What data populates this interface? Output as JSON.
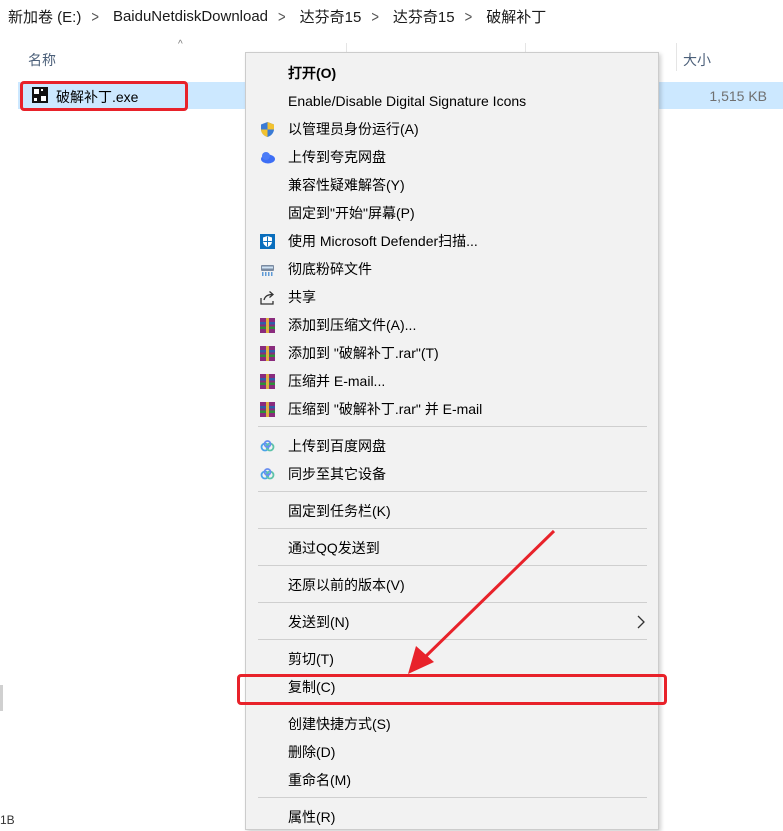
{
  "breadcrumb": {
    "items": [
      "新加卷 (E:)",
      "BaiduNetdiskDownload",
      "达芬奇15",
      "达芬奇15",
      "破解补丁"
    ],
    "separator": ">"
  },
  "file_list": {
    "header": {
      "name": "名称",
      "size": "大小"
    },
    "row": {
      "name": "破解补丁.exe",
      "size": "1,515 KB"
    }
  },
  "status_bar": {
    "fragment": "1B"
  },
  "context_menu": {
    "items": [
      {
        "label": "打开(O)",
        "bold": true
      },
      {
        "label": "Enable/Disable Digital Signature Icons"
      },
      {
        "label": "以管理员身份运行(A)",
        "icon": "uac-shield-icon"
      },
      {
        "label": "上传到夸克网盘",
        "icon": "quark-cloud-icon"
      },
      {
        "label": "兼容性疑难解答(Y)"
      },
      {
        "label": "固定到\"开始\"屏幕(P)"
      },
      {
        "label": "使用 Microsoft Defender扫描...",
        "icon": "defender-icon"
      },
      {
        "label": "彻底粉碎文件",
        "icon": "shredder-icon"
      },
      {
        "label": "共享",
        "icon": "share-icon"
      },
      {
        "label": "添加到压缩文件(A)...",
        "icon": "winrar-icon"
      },
      {
        "label": "添加到 \"破解补丁.rar\"(T)",
        "icon": "winrar-icon"
      },
      {
        "label": "压缩并 E-mail...",
        "icon": "winrar-icon"
      },
      {
        "label": "压缩到 \"破解补丁.rar\" 并 E-mail",
        "icon": "winrar-icon"
      },
      {
        "label": "上传到百度网盘",
        "icon": "baidu-cloud-icon"
      },
      {
        "label": "同步至其它设备",
        "icon": "baidu-cloud-icon"
      },
      {
        "label": "固定到任务栏(K)"
      },
      {
        "label": "通过QQ发送到"
      },
      {
        "label": "还原以前的版本(V)"
      },
      {
        "label": "发送到(N)",
        "submenu": true
      },
      {
        "label": "剪切(T)"
      },
      {
        "label": "复制(C)",
        "highlighted": true
      },
      {
        "label": "创建快捷方式(S)"
      },
      {
        "label": "删除(D)"
      },
      {
        "label": "重命名(M)"
      },
      {
        "label": "属性(R)"
      }
    ]
  },
  "colors": {
    "selection": "#cce8ff",
    "annotation_red": "#e8222a",
    "menu_bg": "#f2f2f2"
  }
}
